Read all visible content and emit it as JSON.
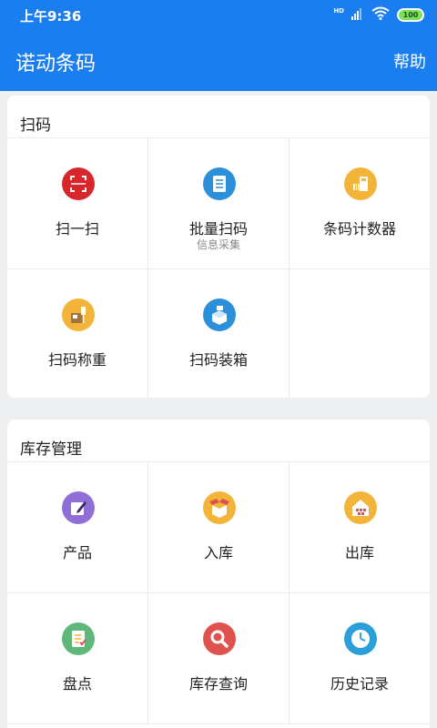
{
  "status": {
    "time": "上午9:36",
    "network": "HD",
    "battery": "100"
  },
  "header": {
    "title": "诺动条码",
    "help_label": "帮助"
  },
  "sections": [
    {
      "title": "扫码",
      "items": [
        {
          "label": "扫一扫",
          "sublabel": "",
          "icon": "scan-frame-icon",
          "color": "#d9262c"
        },
        {
          "label": "批量扫码",
          "sublabel": "信息采集",
          "icon": "list-document-icon",
          "color": "#2b8fd9"
        },
        {
          "label": "条码计数器",
          "sublabel": "",
          "icon": "barcode-counter-icon",
          "color": "#f2b53a"
        },
        {
          "label": "扫码称重",
          "sublabel": "",
          "icon": "scale-weigh-icon",
          "color": "#f2b53a"
        },
        {
          "label": "扫码装箱",
          "sublabel": "",
          "icon": "packing-box-icon",
          "color": "#2b8fd9"
        }
      ]
    },
    {
      "title": "库存管理",
      "items": [
        {
          "label": "产品",
          "sublabel": "",
          "icon": "product-edit-icon",
          "color": "#8f6fd6"
        },
        {
          "label": "入库",
          "sublabel": "",
          "icon": "inbound-box-icon",
          "color": "#f2b53a"
        },
        {
          "label": "出库",
          "sublabel": "",
          "icon": "warehouse-icon",
          "color": "#f2b53a"
        },
        {
          "label": "盘点",
          "sublabel": "",
          "icon": "stocktake-checklist-icon",
          "color": "#5fb87a"
        },
        {
          "label": "库存查询",
          "sublabel": "",
          "icon": "search-icon",
          "color": "#e0524d"
        },
        {
          "label": "历史记录",
          "sublabel": "",
          "icon": "clock-history-icon",
          "color": "#2b9fd9"
        }
      ]
    }
  ]
}
